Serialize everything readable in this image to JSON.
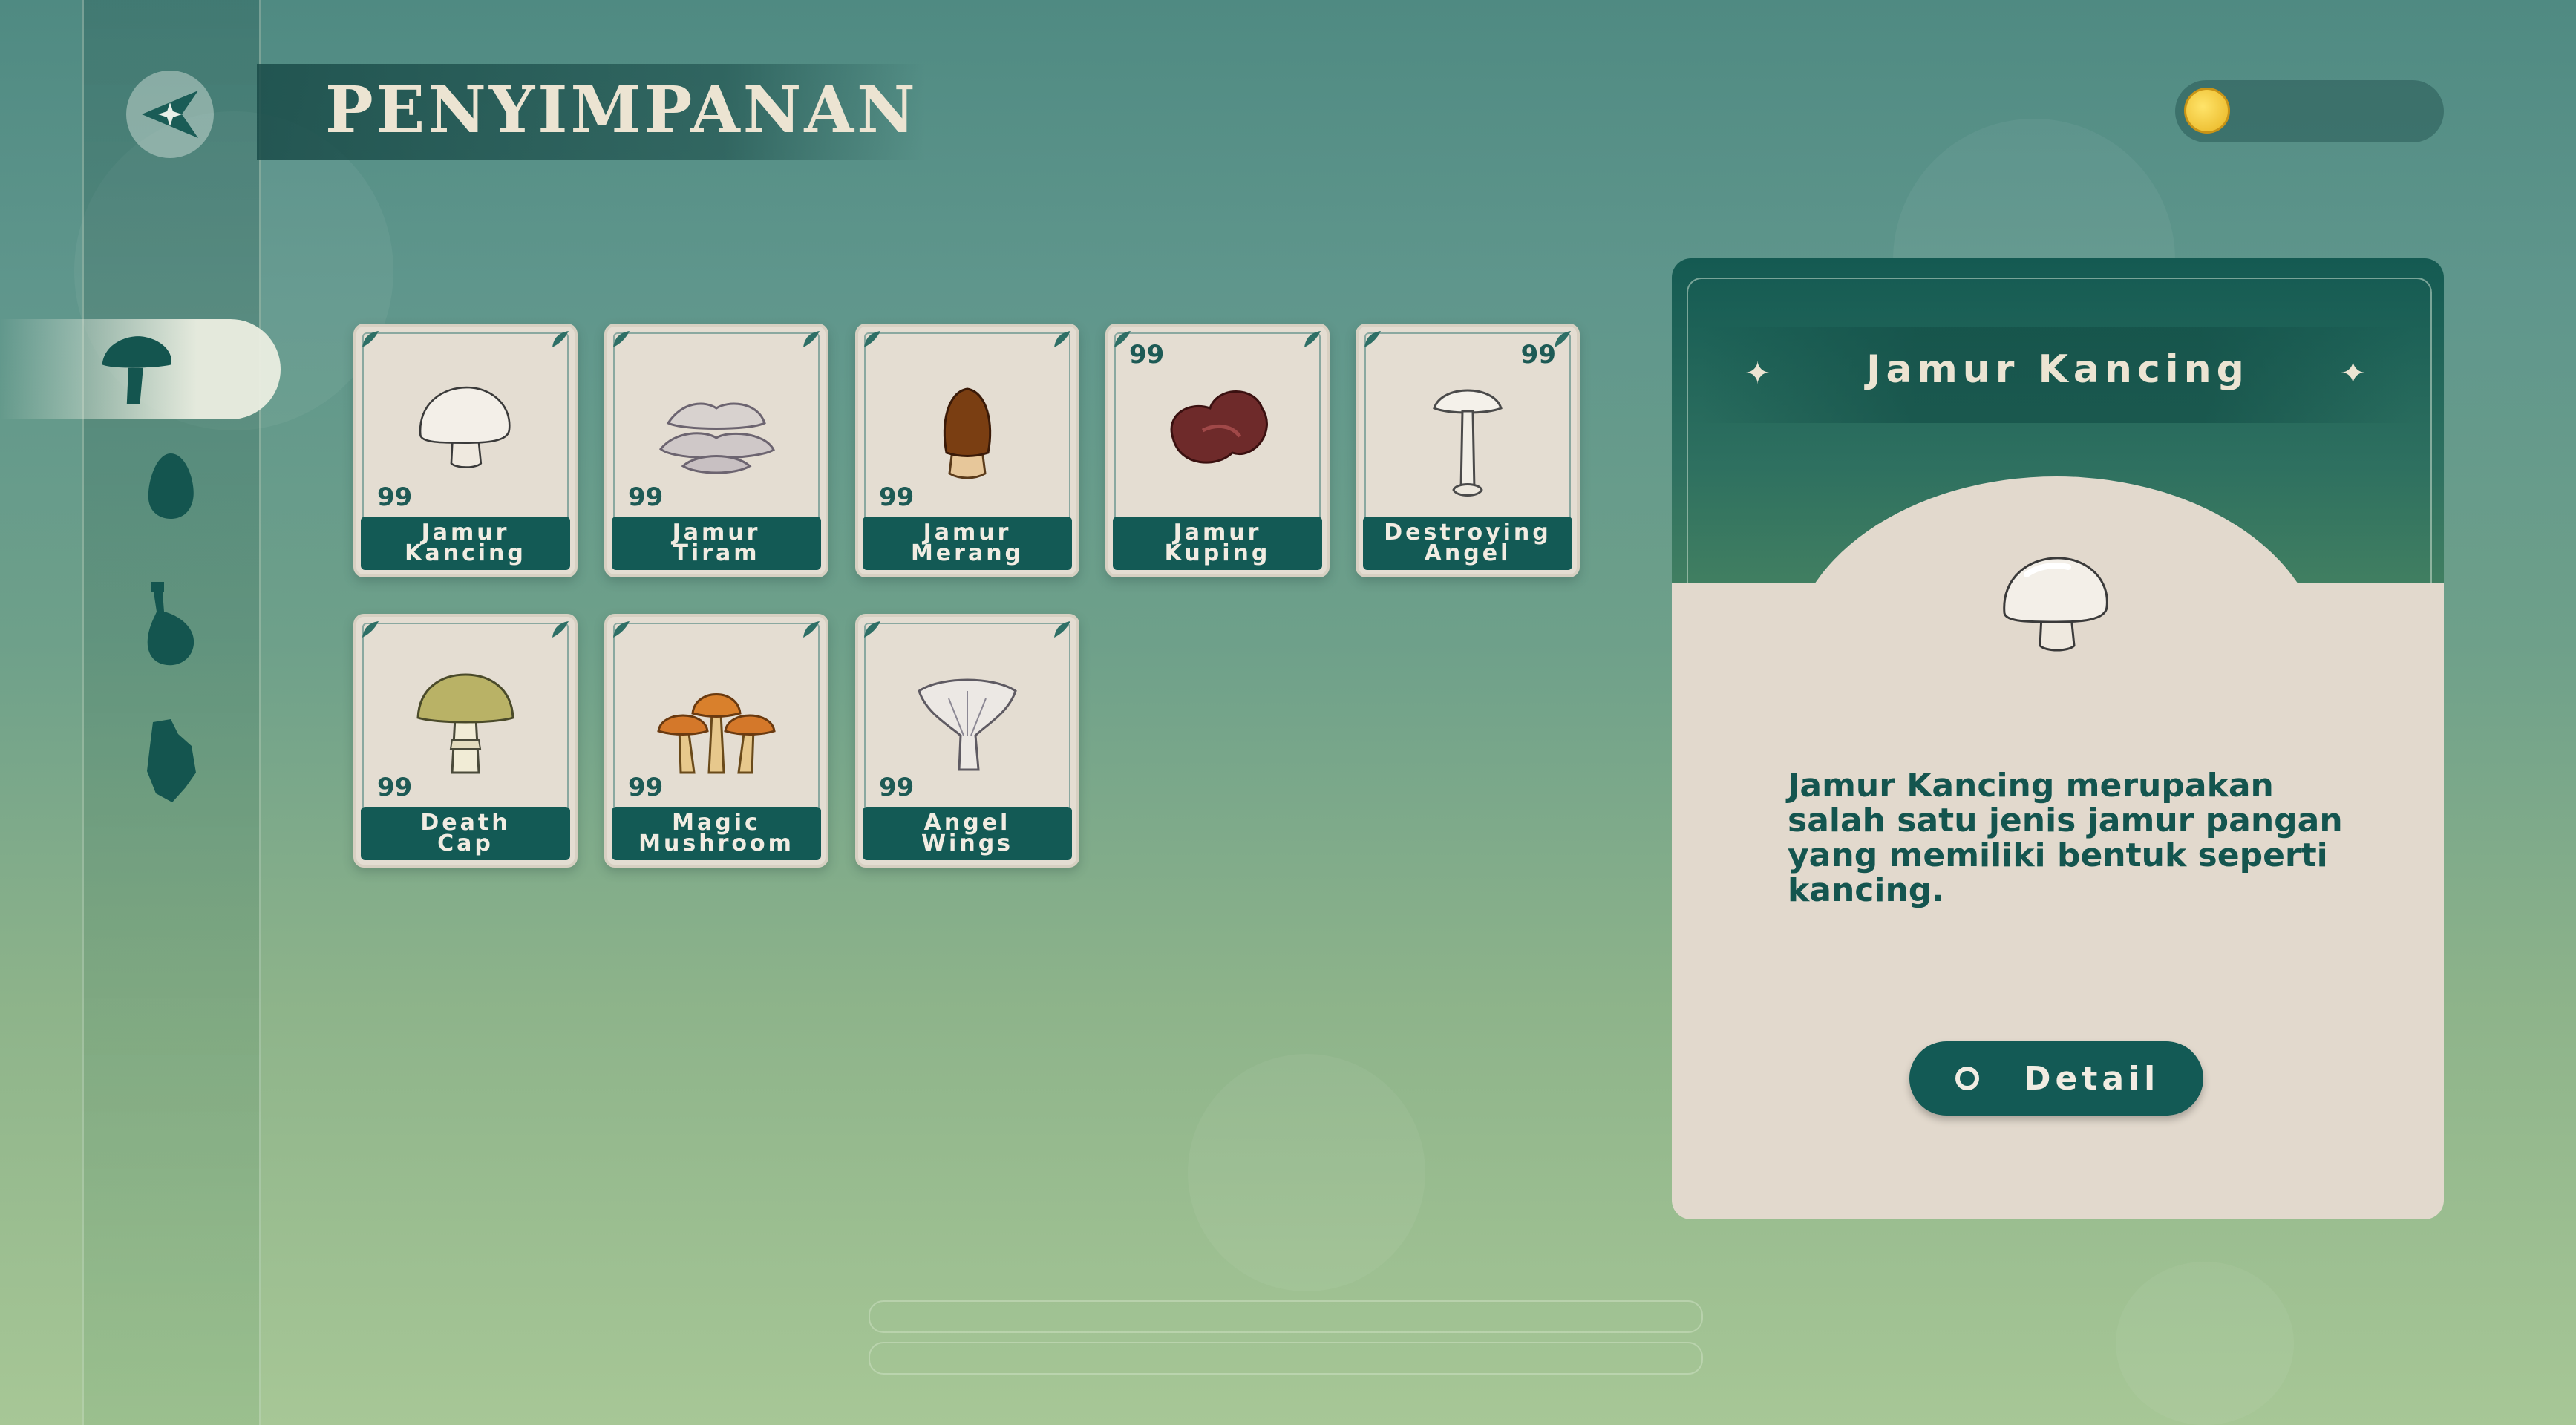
{
  "header": {
    "title": "PENYIMPANAN",
    "coin_value": ""
  },
  "tabs": [
    {
      "id": "mushroom",
      "icon": "mushroom-icon",
      "active": true
    },
    {
      "id": "egg",
      "icon": "egg-icon",
      "active": false
    },
    {
      "id": "potion",
      "icon": "potion-icon",
      "active": false
    },
    {
      "id": "rock",
      "icon": "rock-icon",
      "active": false
    }
  ],
  "inventory": [
    {
      "name": "Jamur\nKancing",
      "qty": "99",
      "qty_pos": "bottom-left",
      "icon": "button-mushroom-icon"
    },
    {
      "name": "Jamur\nTiram",
      "qty": "99",
      "qty_pos": "bottom-left",
      "icon": "oyster-mushroom-icon"
    },
    {
      "name": "Jamur\nMerang",
      "qty": "99",
      "qty_pos": "bottom-left",
      "icon": "straw-mushroom-icon"
    },
    {
      "name": "Jamur\nKuping",
      "qty": "99",
      "qty_pos": "top-left",
      "icon": "wood-ear-mushroom-icon"
    },
    {
      "name": "Destroying\nAngel",
      "qty": "99",
      "qty_pos": "top-right",
      "icon": "destroying-angel-icon"
    },
    {
      "name": "Death\nCap",
      "qty": "99",
      "qty_pos": "bottom-left",
      "icon": "death-cap-icon"
    },
    {
      "name": "Magic\nMushroom",
      "qty": "99",
      "qty_pos": "bottom-left",
      "icon": "magic-mushroom-icon"
    },
    {
      "name": "Angel\nWings",
      "qty": "99",
      "qty_pos": "bottom-left",
      "icon": "angel-wings-icon"
    }
  ],
  "detail": {
    "title": "Jamur Kancing",
    "description": "Jamur Kancing merupakan salah satu jenis jamur pangan yang memiliki bentuk seperti kancing.",
    "button_label": "Detail"
  },
  "colors": {
    "primary": "#135a55",
    "card_bg": "#e4ddd2",
    "text_light": "#f1ece2"
  }
}
